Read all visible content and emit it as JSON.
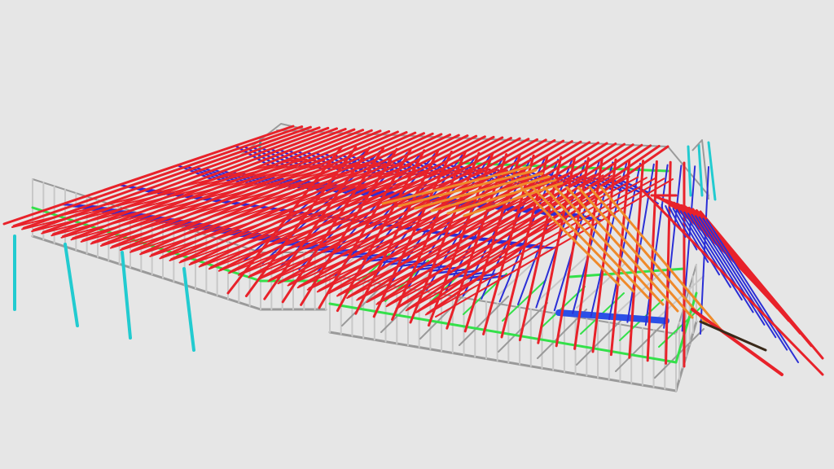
{
  "scene": {
    "subject": "steel-roof-truss-frame-model",
    "colors": {
      "background": "#e6e6e6",
      "wall_frame": "#9a9a9a",
      "wall_frame_light": "#c8c8c8",
      "nogging": "#34e04a",
      "truss_chord": "#e8222a",
      "truss_web": "#2b2fd6",
      "girder": "#ef8a2a",
      "posts": "#22cbd0",
      "lintel": "#2b4fe6",
      "dark_member": "#3a2a1a"
    },
    "icons": {
      "model": "building-frame-icon"
    }
  }
}
